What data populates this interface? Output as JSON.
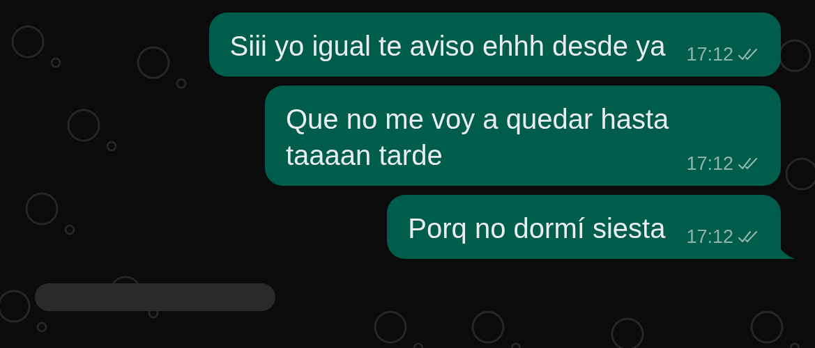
{
  "messages": [
    {
      "kind": "outgoing",
      "text": "Siii yo igual te aviso ehhh desde ya",
      "time": "17:12",
      "read": false,
      "tail": false
    },
    {
      "kind": "outgoing",
      "text": "Que no me voy a quedar hasta taaaan tarde",
      "time": "17:12",
      "read": false,
      "tail": false
    },
    {
      "kind": "outgoing",
      "text": "Porq no dormí siesta",
      "time": "17:12",
      "read": false,
      "tail": true
    },
    {
      "kind": "incoming"
    }
  ]
}
